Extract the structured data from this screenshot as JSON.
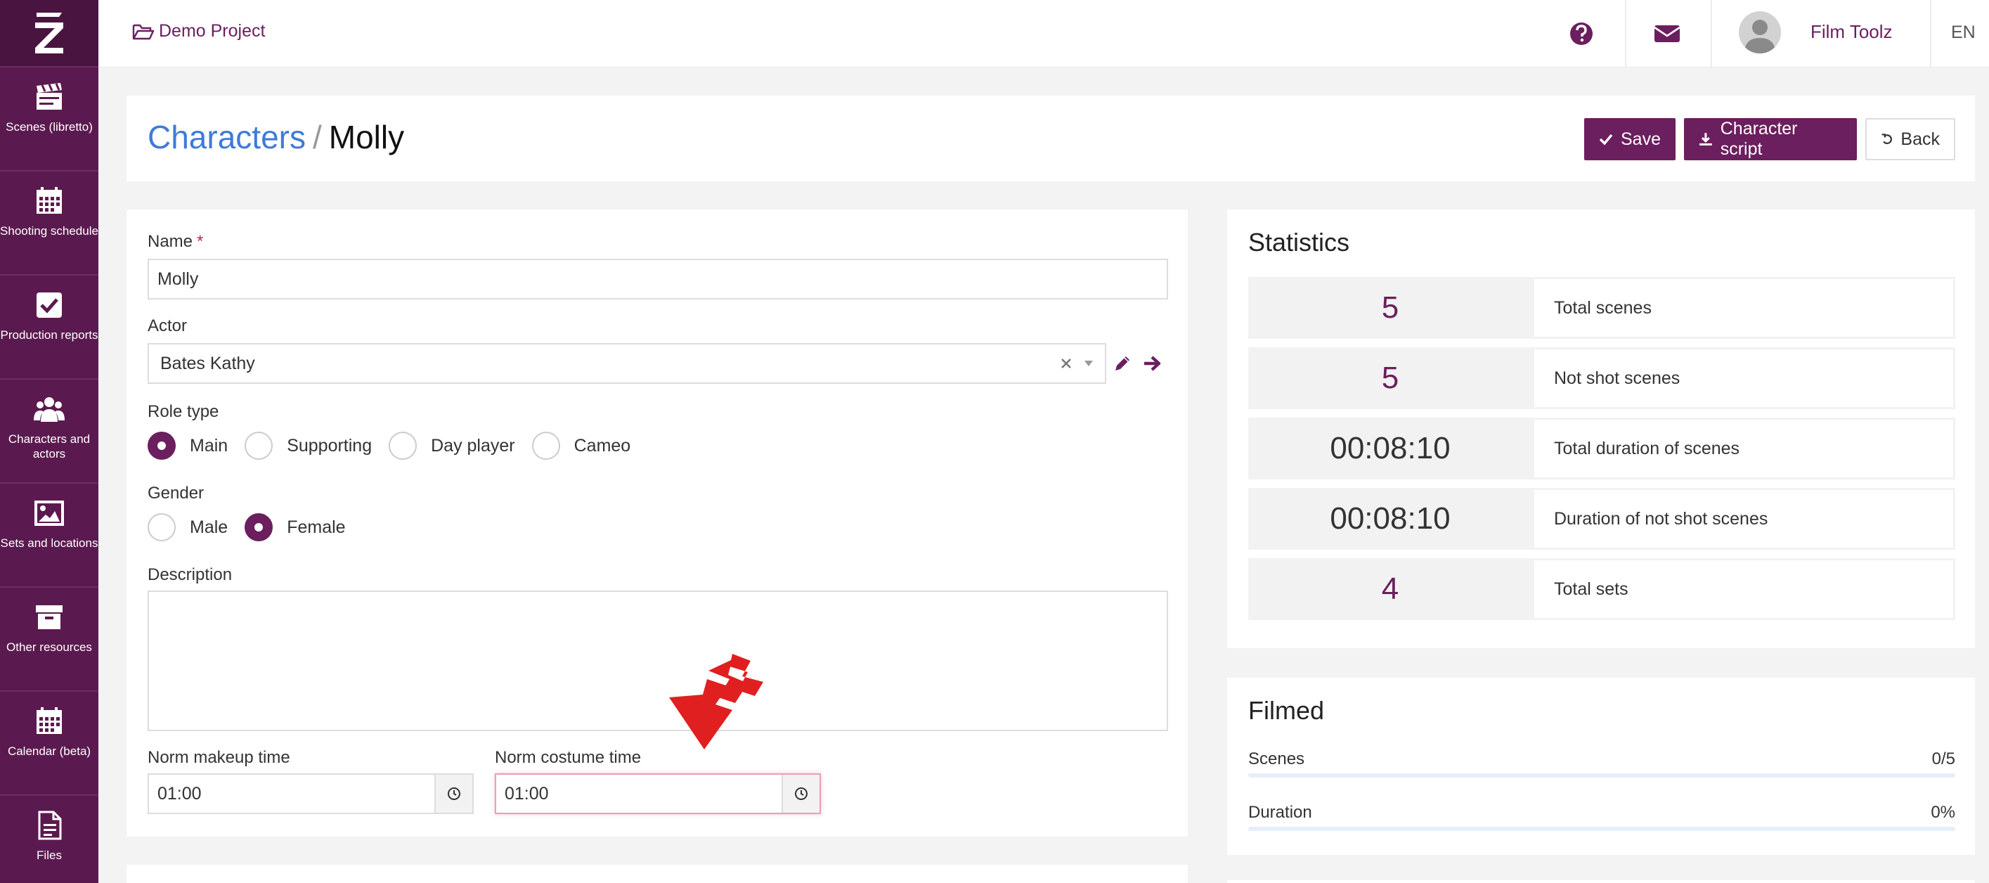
{
  "sidebar": {
    "items": [
      {
        "label": "Scenes (libretto)",
        "icon": "clapperboard-icon"
      },
      {
        "label": "Shooting schedule",
        "icon": "calendar-icon"
      },
      {
        "label": "Production reports",
        "icon": "checkbox-icon"
      },
      {
        "label": "Characters and actors",
        "icon": "users-icon"
      },
      {
        "label": "Sets and locations",
        "icon": "image-icon"
      },
      {
        "label": "Other resources",
        "icon": "archive-icon"
      },
      {
        "label": "Calendar (beta)",
        "icon": "calendar-icon"
      },
      {
        "label": "Files",
        "icon": "file-icon"
      }
    ]
  },
  "topbar": {
    "project": "Demo Project",
    "user": "Film Toolz",
    "language": "EN"
  },
  "header": {
    "crumb_link": "Characters",
    "crumb_sep": "/",
    "crumb_current": "Molly",
    "save_label": "Save",
    "script_label": "Character script",
    "back_label": "Back"
  },
  "form": {
    "name_label": "Name",
    "name_required": "*",
    "name_value": "Molly",
    "actor_label": "Actor",
    "actor_value": "Bates Kathy",
    "role_label": "Role type",
    "roles": [
      "Main",
      "Supporting",
      "Day player",
      "Cameo"
    ],
    "role_selected": "Main",
    "gender_label": "Gender",
    "genders": [
      "Male",
      "Female"
    ],
    "gender_selected": "Female",
    "description_label": "Description",
    "description_value": "",
    "makeup_label": "Norm makeup time",
    "makeup_value": "01:00",
    "costume_label": "Norm costume time",
    "costume_value": "01:00"
  },
  "statistics": {
    "title": "Statistics",
    "rows": [
      {
        "value": "5",
        "label": "Total scenes"
      },
      {
        "value": "5",
        "label": "Not shot scenes"
      },
      {
        "value": "00:08:10",
        "label": "Total duration of scenes"
      },
      {
        "value": "00:08:10",
        "label": "Duration of not shot scenes"
      },
      {
        "value": "4",
        "label": "Total sets"
      }
    ]
  },
  "filmed": {
    "title": "Filmed",
    "scenes_label": "Scenes",
    "scenes_value": "0/5",
    "duration_label": "Duration",
    "duration_value": "0%"
  },
  "colors": {
    "brand": "#6b1f5e",
    "sidebar": "#5b1a4f",
    "link": "#3f7bd8",
    "pointer": "#e02020"
  }
}
